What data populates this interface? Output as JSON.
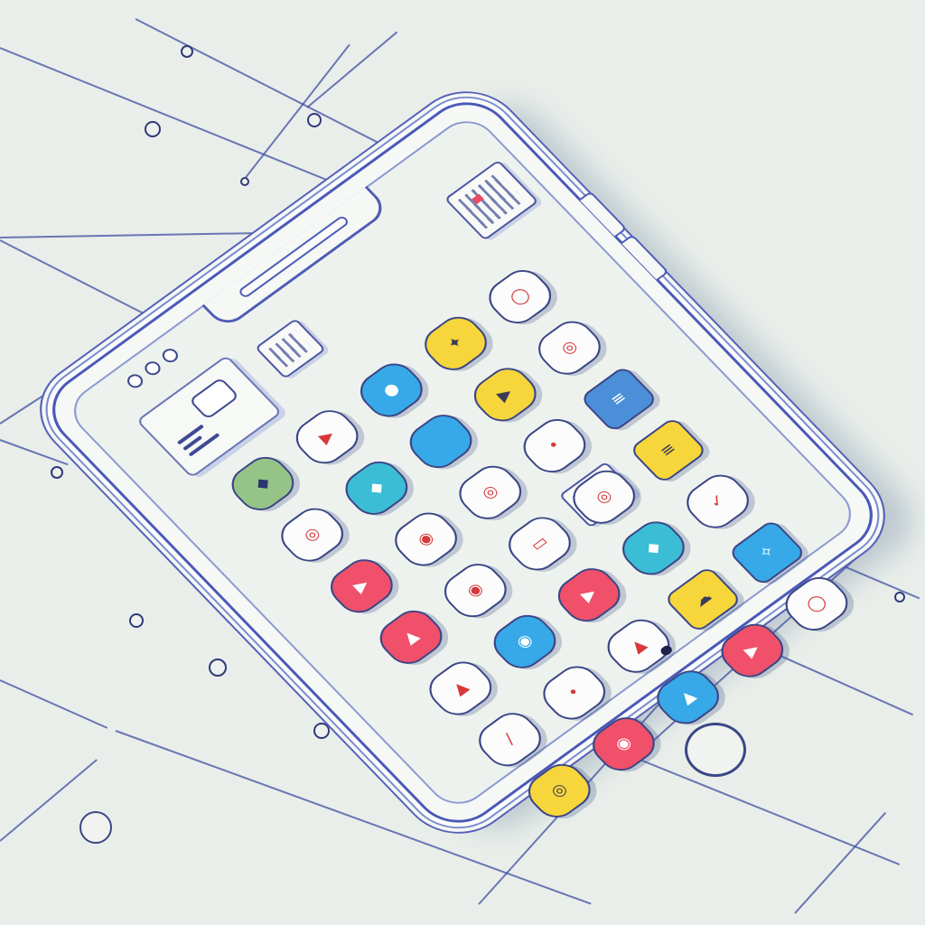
{
  "scene": {
    "description_color": "#e9eeea",
    "phone": {
      "status_text": "4 ᴛ◦◦",
      "colors": {
        "outline": "#4a59b8",
        "yellow": "#f6d63a",
        "teal": "#3bbdd6",
        "blue": "#37a8e8",
        "red": "#f0506a",
        "green": "#95c486",
        "white": "#fbfcfb"
      },
      "apps": [
        {
          "name": "app-green",
          "color": "green",
          "icon": "droplet-icon"
        },
        {
          "name": "app-play-white",
          "color": "white",
          "icon": "play-icon"
        },
        {
          "name": "app-blue-top",
          "color": "blue",
          "icon": "drop-icon"
        },
        {
          "name": "app-yellow-1",
          "color": "yellow",
          "icon": "spark-icon"
        },
        {
          "name": "app-ring-1",
          "color": "white",
          "icon": "ring-icon"
        },
        {
          "name": "app-ring-2",
          "color": "white",
          "icon": "spiral-icon"
        },
        {
          "name": "app-teal-1",
          "color": "teal",
          "icon": "gem-icon"
        },
        {
          "name": "app-blue-1",
          "color": "blue",
          "icon": "blank-icon"
        },
        {
          "name": "app-yellow-play",
          "color": "yellow",
          "icon": "play-icon"
        },
        {
          "name": "app-ring-3",
          "color": "white",
          "icon": "spiral-icon"
        },
        {
          "name": "app-red-play",
          "color": "red",
          "icon": "play-icon"
        },
        {
          "name": "app-ring-4",
          "color": "white",
          "icon": "target-icon"
        },
        {
          "name": "app-ring-5",
          "color": "white",
          "icon": "spiral-icon"
        },
        {
          "name": "app-ring-6",
          "color": "white",
          "icon": "dot-icon"
        },
        {
          "name": "app-blue-note",
          "color": "navy",
          "icon": "note-icon"
        },
        {
          "name": "app-red-2",
          "color": "red",
          "icon": "triangle-icon"
        },
        {
          "name": "app-ring-7",
          "color": "white",
          "icon": "target-icon"
        },
        {
          "name": "app-card",
          "color": "white",
          "icon": "card-icon"
        },
        {
          "name": "app-ring-8",
          "color": "white",
          "icon": "spiral-icon"
        },
        {
          "name": "app-yellow-note",
          "color": "yellow",
          "icon": "note-icon"
        },
        {
          "name": "app-white-triangle",
          "color": "white",
          "icon": "triangle-icon"
        },
        {
          "name": "app-blue-2",
          "color": "blue",
          "icon": "target-icon"
        },
        {
          "name": "app-red-3",
          "color": "red",
          "icon": "play-icon"
        },
        {
          "name": "app-teal-2",
          "color": "teal",
          "icon": "gem-icon"
        },
        {
          "name": "app-white-check",
          "color": "white",
          "icon": "check-icon"
        },
        {
          "name": "app-white-slash",
          "color": "white",
          "icon": "slash-icon"
        },
        {
          "name": "app-white-dot",
          "color": "white",
          "icon": "dot-icon"
        },
        {
          "name": "app-white-tri2",
          "color": "white",
          "icon": "triangle-icon"
        },
        {
          "name": "app-yellow-2",
          "color": "yellow",
          "icon": "blob-icon"
        },
        {
          "name": "app-blue-3",
          "color": "blue",
          "icon": "bird-icon"
        },
        {
          "name": "app-yellow-3",
          "color": "yellow",
          "icon": "spiral-icon"
        },
        {
          "name": "app-red-4",
          "color": "red",
          "icon": "target-icon"
        },
        {
          "name": "app-blue-4",
          "color": "blue",
          "icon": "triangle-icon"
        },
        {
          "name": "app-red-5",
          "color": "red",
          "icon": "play-icon"
        },
        {
          "name": "app-white-last",
          "color": "white",
          "icon": "ring-icon"
        }
      ]
    }
  }
}
